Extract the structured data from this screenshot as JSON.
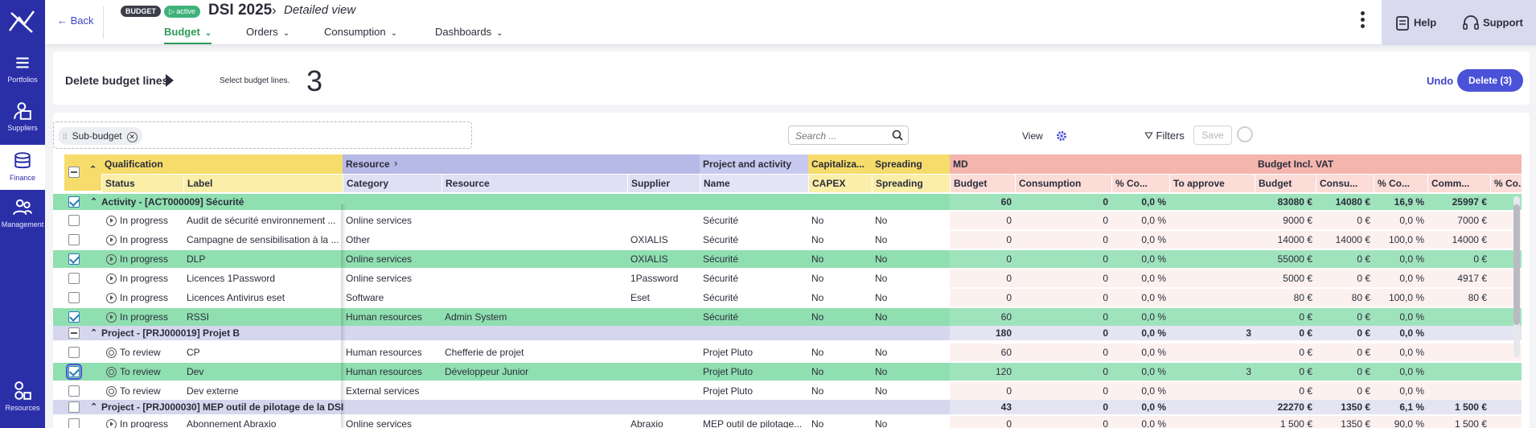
{
  "sidebar": {
    "items": [
      {
        "label": "Portfolios",
        "icon": "portfolio-icon"
      },
      {
        "label": "Suppliers",
        "icon": "supplier-icon"
      },
      {
        "label": "Finance",
        "icon": "finance-icon",
        "active": true
      },
      {
        "label": "Management",
        "icon": "management-icon"
      },
      {
        "label": "Resources",
        "icon": "resources-icon"
      }
    ]
  },
  "header": {
    "back_label": "Back",
    "badge_budget": "BUDGET",
    "badge_active": "active",
    "title": "DSI 2025",
    "subtitle": "Detailed view",
    "tabs": [
      {
        "label": "Budget",
        "active": true
      },
      {
        "label": "Orders"
      },
      {
        "label": "Consumption"
      },
      {
        "label": "Dashboards"
      }
    ],
    "help_label": "Help",
    "support_label": "Support"
  },
  "actionbar": {
    "title": "Delete budget lines",
    "hint": "Select budget lines.",
    "count": "3",
    "undo_label": "Undo",
    "delete_label": "Delete (3)"
  },
  "toolbar": {
    "chip_label": "Sub-budget",
    "search_placeholder": "Search ...",
    "view_label": "View",
    "filters_label": "Filters",
    "save_label": "Save"
  },
  "columns": {
    "groups": [
      "Qualification",
      "Resource",
      "Project and activity",
      "Capitaliza...",
      "Spreading",
      "MD",
      "Budget Incl. VAT"
    ],
    "headers": [
      "Status",
      "Label",
      "Category",
      "Resource",
      "Supplier",
      "Name",
      "CAPEX",
      "Spreading",
      "Budget",
      "Consumption",
      "% Co...",
      "To approve",
      "Budget",
      "Consu...",
      "% Co...",
      "Comm...",
      "% Co..."
    ]
  },
  "colors": {
    "qualification": "#f6dc6b",
    "resource": "#b7b9e6",
    "project": "#c7c9ee",
    "capex": "#f6dc6b",
    "md": "#f3b5ae",
    "vat": "#f3b5ae",
    "selected_row": "#8fdfb0"
  },
  "rows": [
    {
      "kind": "group",
      "expanded": true,
      "checked": true,
      "title": "Activity - [ACT000009] Sécurité",
      "md_budget": "60",
      "md_cons": "0",
      "md_pct": "0,0 %",
      "md_appr": "",
      "vat_budget": "83080 €",
      "vat_cons": "14080 €",
      "vat_pct": "16,9 %",
      "vat_comm": "25997 €",
      "color": "green"
    },
    {
      "kind": "line",
      "checked": false,
      "status": "In progress",
      "stat": "play",
      "label": "Audit de sécurité environnement ...",
      "category": "Online services",
      "resource": "",
      "supplier": "",
      "name": "Sécurité",
      "capex": "No",
      "spreading": "No",
      "md_budget": "0",
      "md_cons": "0",
      "md_pct": "0,0 %",
      "md_appr": "",
      "vat_budget": "9000 €",
      "vat_cons": "0 €",
      "vat_pct": "0,0 %",
      "vat_comm": "7000 €"
    },
    {
      "kind": "line",
      "checked": false,
      "status": "In progress",
      "stat": "play",
      "label": "Campagne de sensibilisation à la ...",
      "category": "Other",
      "resource": "",
      "supplier": "OXIALIS",
      "name": "Sécurité",
      "capex": "No",
      "spreading": "No",
      "md_budget": "0",
      "md_cons": "0",
      "md_pct": "0,0 %",
      "md_appr": "",
      "vat_budget": "14000 €",
      "vat_cons": "14000 €",
      "vat_pct": "100,0 %",
      "vat_comm": "14000 €"
    },
    {
      "kind": "line",
      "checked": true,
      "status": "In progress",
      "stat": "play",
      "label": "DLP",
      "category": "Online services",
      "resource": "",
      "supplier": "OXIALIS",
      "name": "Sécurité",
      "capex": "No",
      "spreading": "No",
      "md_budget": "0",
      "md_cons": "0",
      "md_pct": "0,0 %",
      "md_appr": "",
      "vat_budget": "55000 €",
      "vat_cons": "0 €",
      "vat_pct": "0,0 %",
      "vat_comm": "0 €"
    },
    {
      "kind": "line",
      "checked": false,
      "status": "In progress",
      "stat": "play",
      "label": "Licences 1Password",
      "category": "Online services",
      "resource": "",
      "supplier": "1Password",
      "name": "Sécurité",
      "capex": "No",
      "spreading": "No",
      "md_budget": "0",
      "md_cons": "0",
      "md_pct": "0,0 %",
      "md_appr": "",
      "vat_budget": "5000 €",
      "vat_cons": "0 €",
      "vat_pct": "0,0 %",
      "vat_comm": "4917 €"
    },
    {
      "kind": "line",
      "checked": false,
      "status": "In progress",
      "stat": "play",
      "label": "Licences Antivirus eset",
      "category": "Software",
      "resource": "",
      "supplier": "Eset",
      "name": "Sécurité",
      "capex": "No",
      "spreading": "No",
      "md_budget": "0",
      "md_cons": "0",
      "md_pct": "0,0 %",
      "md_appr": "",
      "vat_budget": "80 €",
      "vat_cons": "80 €",
      "vat_pct": "100,0 %",
      "vat_comm": "80 €"
    },
    {
      "kind": "line",
      "checked": true,
      "status": "In progress",
      "stat": "play",
      "label": "RSSI",
      "category": "Human resources",
      "resource": "Admin System",
      "supplier": "",
      "name": "Sécurité",
      "capex": "No",
      "spreading": "No",
      "md_budget": "60",
      "md_cons": "0",
      "md_pct": "0,0 %",
      "md_appr": "",
      "vat_budget": "0 €",
      "vat_cons": "0 €",
      "vat_pct": "0,0 %",
      "vat_comm": ""
    },
    {
      "kind": "group",
      "expanded": true,
      "checked": false,
      "indeterminate": true,
      "title": "Project - [PRJ000019] Projet B",
      "md_budget": "180",
      "md_cons": "0",
      "md_pct": "0,0 %",
      "md_appr": "3",
      "vat_budget": "0 €",
      "vat_cons": "0 €",
      "vat_pct": "0,0 %",
      "vat_comm": "",
      "color": "purple"
    },
    {
      "kind": "line",
      "checked": false,
      "status": "To review",
      "stat": "review",
      "label": "CP",
      "category": "Human resources",
      "resource": "Chefferie de projet",
      "supplier": "",
      "name": "Projet Pluto",
      "capex": "No",
      "spreading": "No",
      "md_budget": "60",
      "md_cons": "0",
      "md_pct": "0,0 %",
      "md_appr": "",
      "vat_budget": "0 €",
      "vat_cons": "0 €",
      "vat_pct": "0,0 %",
      "vat_comm": ""
    },
    {
      "kind": "line",
      "checked": true,
      "focus": true,
      "status": "To review",
      "stat": "review",
      "label": "Dev",
      "category": "Human resources",
      "resource": "Développeur Junior",
      "supplier": "",
      "name": "Projet Pluto",
      "capex": "No",
      "spreading": "No",
      "md_budget": "120",
      "md_cons": "0",
      "md_pct": "0,0 %",
      "md_appr": "3",
      "vat_budget": "0 €",
      "vat_cons": "0 €",
      "vat_pct": "0,0 %",
      "vat_comm": ""
    },
    {
      "kind": "line",
      "checked": false,
      "status": "To review",
      "stat": "review",
      "label": "Dev externe",
      "category": "External services",
      "resource": "",
      "supplier": "",
      "name": "Projet Pluto",
      "capex": "No",
      "spreading": "No",
      "md_budget": "0",
      "md_cons": "0",
      "md_pct": "0,0 %",
      "md_appr": "",
      "vat_budget": "0 €",
      "vat_cons": "0 €",
      "vat_pct": "0,0 %",
      "vat_comm": ""
    },
    {
      "kind": "group",
      "expanded": true,
      "checked": false,
      "title": "Project - [PRJ000030] MEP outil de pilotage de la DSI",
      "md_budget": "43",
      "md_cons": "0",
      "md_pct": "0,0 %",
      "md_appr": "",
      "vat_budget": "22270 €",
      "vat_cons": "1350 €",
      "vat_pct": "6,1 %",
      "vat_comm": "1 500 €",
      "color": "purple"
    },
    {
      "kind": "line",
      "checked": false,
      "status": "In progress",
      "stat": "play",
      "label": "Abonnement Abraxio",
      "category": "Online services",
      "resource": "",
      "supplier": "Abraxio",
      "name": "MEP outil de pilotage...",
      "capex": "No",
      "spreading": "No",
      "md_budget": "0",
      "md_cons": "0",
      "md_pct": "0,0 %",
      "md_appr": "",
      "vat_budget": "1 500 €",
      "vat_cons": "1350 €",
      "vat_pct": "90,0 %",
      "vat_comm": "1 500 €"
    }
  ]
}
